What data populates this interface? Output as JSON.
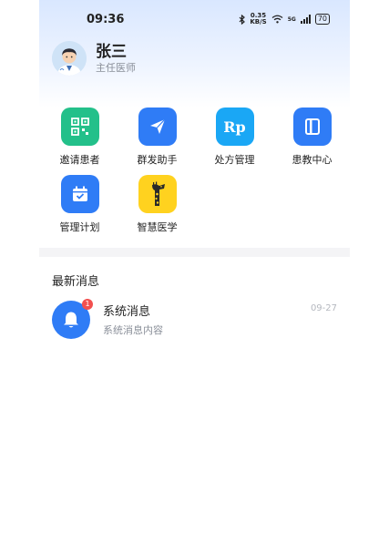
{
  "status": {
    "time": "09:36",
    "net_speed_value": "0.35",
    "net_speed_unit": "KB/S",
    "signal_label": "5G",
    "battery": "70"
  },
  "profile": {
    "name": "张三",
    "title": "主任医师"
  },
  "shortcuts": [
    {
      "label": "邀请患者",
      "icon": "qrcode-icon",
      "color": "#23c08a"
    },
    {
      "label": "群发助手",
      "icon": "send-icon",
      "color": "#2f7cf6"
    },
    {
      "label": "处方管理",
      "icon": "rp-icon",
      "icon_text": "Rp",
      "color": "#1aa7f5"
    },
    {
      "label": "患教中心",
      "icon": "book-icon",
      "color": "#2f7cf6"
    },
    {
      "label": "管理计划",
      "icon": "calendar-check-icon",
      "color": "#2f7cf6"
    },
    {
      "label": "智慧医学",
      "icon": "giraffe-icon",
      "color": "#ffd21f"
    }
  ],
  "messages_section": {
    "title": "最新消息",
    "items": [
      {
        "title": "系统消息",
        "subtitle": "系统消息内容",
        "date": "09-27",
        "badge": "1",
        "icon": "bell-icon"
      }
    ]
  }
}
